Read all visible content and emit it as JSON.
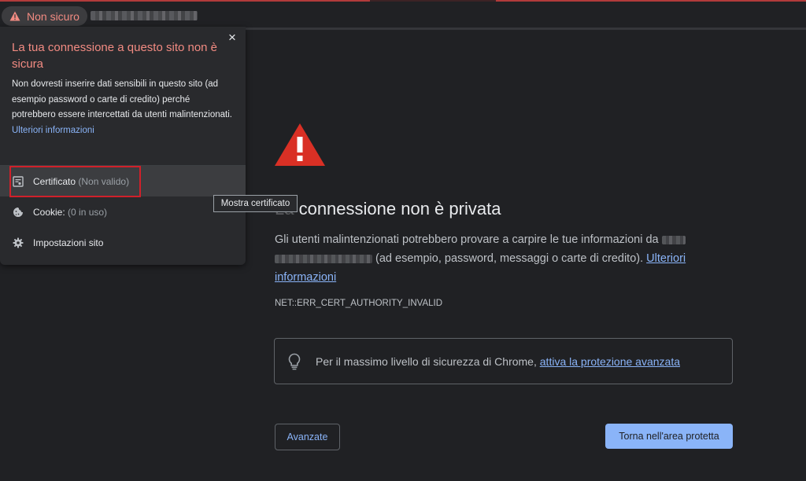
{
  "topbar": {
    "security_chip_label": "Non sicuro"
  },
  "popup": {
    "close_label": "×",
    "title": "La tua connessione a questo sito non è sicura",
    "body": "Non dovresti inserire dati sensibili in questo sito (ad esempio password o carte di credito) perché potrebbero essere intercettati da utenti malintenzionati.",
    "learn_more": "Ulteriori informazioni",
    "items": [
      {
        "label": "Certificato",
        "secondary": "(Non valido)",
        "icon": "certificate-icon"
      },
      {
        "label": "Cookie:",
        "secondary": "(0 in uso)",
        "icon": "cookie-icon"
      },
      {
        "label": "Impostazioni sito",
        "secondary": "",
        "icon": "gear-icon"
      }
    ],
    "tooltip": "Mostra certificato"
  },
  "interstitial": {
    "heading": "La connessione non è privata",
    "desc_part1": "Gli utenti malintenzionati potrebbero provare a carpire le tue informazioni da",
    "desc_part2": "(ad esempio, password, messaggi o carte di credito).",
    "desc_link": "Ulteriori informazioni",
    "error_code": "NET::ERR_CERT_AUTHORITY_INVALID",
    "enhanced_text": "Per il massimo livello di sicurezza di Chrome,",
    "enhanced_link": "attiva la protezione avanzata",
    "advanced_button": "Avanzate",
    "back_button": "Torna nell'area protetta"
  },
  "colors": {
    "background": "#202124",
    "danger_red": "#d93025",
    "link_blue": "#8ab4f8",
    "title_red": "#f28b82"
  }
}
